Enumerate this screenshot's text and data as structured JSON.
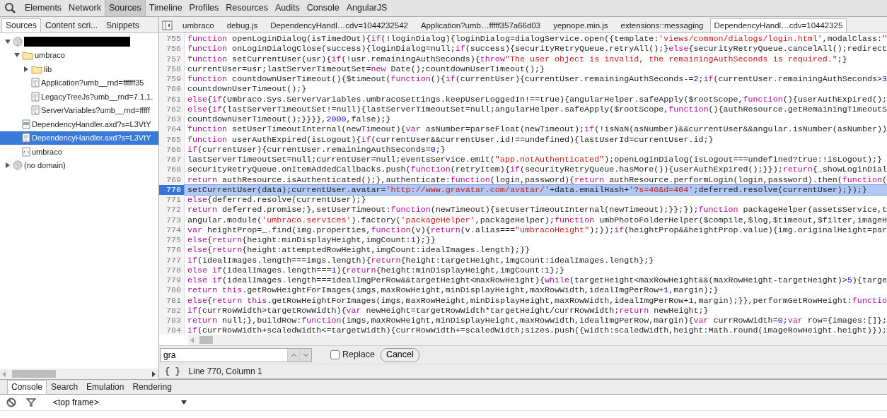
{
  "toolbar": {
    "tabs": [
      {
        "label": "Elements",
        "selected": false
      },
      {
        "label": "Network",
        "selected": false
      },
      {
        "label": "Sources",
        "selected": true
      },
      {
        "label": "Timeline",
        "selected": false
      },
      {
        "label": "Profiles",
        "selected": false
      },
      {
        "label": "Resources",
        "selected": false
      },
      {
        "label": "Audits",
        "selected": false
      },
      {
        "label": "Console",
        "selected": false
      },
      {
        "label": "AngularJS",
        "selected": false
      }
    ]
  },
  "navigator": {
    "tabs": [
      {
        "label": "Sources",
        "selected": true
      },
      {
        "label": "Content scri...",
        "selected": false
      },
      {
        "label": "Snippets",
        "selected": false
      }
    ],
    "tree": [
      {
        "kind": "domain",
        "redacted": true,
        "expanded": true,
        "selected": false,
        "children": [
          {
            "kind": "folder",
            "label": "umbraco",
            "expanded": true,
            "selected": false,
            "children": [
              {
                "kind": "folder",
                "label": "lib",
                "expanded": false,
                "selected": false
              },
              {
                "kind": "script",
                "label": "Application?umb__rnd=ffffff35",
                "selected": false
              },
              {
                "kind": "script",
                "label": "LegacyTreeJs?umb__rnd=7.1.1.",
                "selected": false
              },
              {
                "kind": "script",
                "label": "ServerVariables?umb__rnd=fffff",
                "selected": false
              }
            ]
          },
          {
            "kind": "stylesheet",
            "label": "DependencyHandler.axd?s=L3VtY",
            "selected": false
          },
          {
            "kind": "script",
            "label": "DependencyHandler.axd?s=L3VtY",
            "selected": true
          },
          {
            "kind": "document",
            "label": "umbraco",
            "selected": false
          }
        ]
      },
      {
        "kind": "domain",
        "label": "(no domain)",
        "expanded": false,
        "selected": false
      }
    ]
  },
  "editor": {
    "tabs": [
      {
        "label": "umbraco",
        "selected": false
      },
      {
        "label": "debug.js",
        "selected": false
      },
      {
        "label": "DependencyHandl…cdv=1044232542",
        "selected": false
      },
      {
        "label": "Application?umb…fffff357a66d03",
        "selected": false
      },
      {
        "label": "yepnope.min.js",
        "selected": false
      },
      {
        "label": "extensions::messaging",
        "selected": false
      },
      {
        "label": "DependencyHandl…cdv=10442325",
        "selected": true
      }
    ],
    "lines": [
      {
        "number": "755",
        "selected": false,
        "code": [
          {
            "text": "function",
            "kind": "keyword"
          },
          {
            "text": " openLoginDialog(isTimedOut){",
            "kind": "plain"
          },
          {
            "text": "if",
            "kind": "keyword"
          },
          {
            "text": "(!loginDialog){loginDialog=dialogService.open({template:",
            "kind": "plain"
          },
          {
            "text": "'views/common/dialogs/login.html'",
            "kind": "string"
          },
          {
            "text": ",modalClass:",
            "kind": "plain"
          },
          {
            "text": "\"",
            "kind": "string"
          }
        ]
      },
      {
        "number": "756",
        "selected": false,
        "code": [
          {
            "text": "function",
            "kind": "keyword"
          },
          {
            "text": " onLoginDialogClose(success){loginDialog=null;",
            "kind": "plain"
          },
          {
            "text": "if",
            "kind": "keyword"
          },
          {
            "text": "(success){securityRetryQueue.retryAll();}",
            "kind": "plain"
          },
          {
            "text": "else",
            "kind": "keyword"
          },
          {
            "text": "{securityRetryQueue.cancelAll();redirect",
            "kind": "plain"
          }
        ]
      },
      {
        "number": "757",
        "selected": false,
        "code": [
          {
            "text": "function",
            "kind": "keyword"
          },
          {
            "text": " setCurrentUser(usr){",
            "kind": "plain"
          },
          {
            "text": "if",
            "kind": "keyword"
          },
          {
            "text": "(!usr.remainingAuthSeconds){",
            "kind": "plain"
          },
          {
            "text": "throw",
            "kind": "keyword"
          },
          {
            "text": "\"The user object is invalid, the remainingAuthSeconds is required.\"",
            "kind": "string"
          },
          {
            "text": ";}",
            "kind": "plain"
          }
        ]
      },
      {
        "number": "758",
        "selected": false,
        "code": [
          {
            "text": "currentUser=usr;lastServerTimeoutSet=",
            "kind": "plain"
          },
          {
            "text": "new",
            "kind": "keyword"
          },
          {
            "text": " Date();countdownUserTimeout();}",
            "kind": "plain"
          }
        ]
      },
      {
        "number": "759",
        "selected": false,
        "code": [
          {
            "text": "function",
            "kind": "keyword"
          },
          {
            "text": " countdownUserTimeout(){$timeout(",
            "kind": "plain"
          },
          {
            "text": "function",
            "kind": "keyword"
          },
          {
            "text": "(){",
            "kind": "plain"
          },
          {
            "text": "if",
            "kind": "keyword"
          },
          {
            "text": "(currentUser){currentUser.remainingAuthSeconds-=",
            "kind": "plain"
          },
          {
            "text": "2",
            "kind": "number"
          },
          {
            "text": ";",
            "kind": "plain"
          },
          {
            "text": "if",
            "kind": "keyword"
          },
          {
            "text": "(currentUser.remainingAuthSeconds>",
            "kind": "plain"
          },
          {
            "text": "3",
            "kind": "number"
          }
        ]
      },
      {
        "number": "760",
        "selected": false,
        "code": [
          {
            "text": "countdownUserTimeout();}",
            "kind": "plain"
          }
        ]
      },
      {
        "number": "761",
        "selected": false,
        "code": [
          {
            "text": "else",
            "kind": "keyword"
          },
          {
            "text": "{",
            "kind": "plain"
          },
          {
            "text": "if",
            "kind": "keyword"
          },
          {
            "text": "(Umbraco.Sys.ServerVariables.umbracoSettings.keepUserLoggedIn!==true){angularHelper.safeApply($rootScope,",
            "kind": "plain"
          },
          {
            "text": "function",
            "kind": "keyword"
          },
          {
            "text": "(){userAuthExpired();",
            "kind": "plain"
          }
        ]
      },
      {
        "number": "762",
        "selected": false,
        "code": [
          {
            "text": "else",
            "kind": "keyword"
          },
          {
            "text": "{",
            "kind": "plain"
          },
          {
            "text": "if",
            "kind": "keyword"
          },
          {
            "text": "(lastServerTimeoutSet!=null){lastServerTimeoutSet=null;angularHelper.safeApply($rootScope,",
            "kind": "plain"
          },
          {
            "text": "function",
            "kind": "keyword"
          },
          {
            "text": "(){authResource.getRemainingTimeoutS",
            "kind": "plain"
          }
        ]
      },
      {
        "number": "763",
        "selected": false,
        "code": [
          {
            "text": "countdownUserTimeout();}}}},",
            "kind": "plain"
          },
          {
            "text": "2000",
            "kind": "number"
          },
          {
            "text": ",false);}",
            "kind": "plain"
          }
        ]
      },
      {
        "number": "764",
        "selected": false,
        "code": [
          {
            "text": "function",
            "kind": "keyword"
          },
          {
            "text": " setUserTimeoutInternal(newTimeout){",
            "kind": "plain"
          },
          {
            "text": "var",
            "kind": "keyword"
          },
          {
            "text": " asNumber=parseFloat(newTimeout);",
            "kind": "plain"
          },
          {
            "text": "if",
            "kind": "keyword"
          },
          {
            "text": "(!isNaN(asNumber)&&currentUser&&angular.isNumber(asNumber))",
            "kind": "plain"
          }
        ]
      },
      {
        "number": "765",
        "selected": false,
        "code": [
          {
            "text": "function",
            "kind": "keyword"
          },
          {
            "text": " userAuthExpired(isLogout){",
            "kind": "plain"
          },
          {
            "text": "if",
            "kind": "keyword"
          },
          {
            "text": "(currentUser&&currentUser.id!==undefined){lastUserId=currentUser.id;}",
            "kind": "plain"
          }
        ]
      },
      {
        "number": "766",
        "selected": false,
        "code": [
          {
            "text": "if",
            "kind": "keyword"
          },
          {
            "text": "(currentUser){currentUser.remainingAuthSeconds=",
            "kind": "plain"
          },
          {
            "text": "0",
            "kind": "number"
          },
          {
            "text": ";}",
            "kind": "plain"
          }
        ]
      },
      {
        "number": "767",
        "selected": false,
        "code": [
          {
            "text": "lastServerTimeoutSet=null;currentUser=null;eventsService.emit(",
            "kind": "plain"
          },
          {
            "text": "\"app.notAuthenticated\"",
            "kind": "string"
          },
          {
            "text": ");openLoginDialog(isLogout===undefined?true:!isLogout);}",
            "kind": "plain"
          }
        ]
      },
      {
        "number": "768",
        "selected": false,
        "code": [
          {
            "text": "securityRetryQueue.onItemAddedCallbacks.push(",
            "kind": "plain"
          },
          {
            "text": "function",
            "kind": "keyword"
          },
          {
            "text": "(retryItem){",
            "kind": "plain"
          },
          {
            "text": "if",
            "kind": "keyword"
          },
          {
            "text": "(securityRetryQueue.hasMore()){userAuthExpired();}});",
            "kind": "plain"
          },
          {
            "text": "return",
            "kind": "keyword"
          },
          {
            "text": "{_showLoginDial",
            "kind": "plain"
          }
        ]
      },
      {
        "number": "769",
        "selected": false,
        "code": [
          {
            "text": "return",
            "kind": "keyword"
          },
          {
            "text": " authResource.isAuthenticated();},authenticate:",
            "kind": "plain"
          },
          {
            "text": "function",
            "kind": "keyword"
          },
          {
            "text": "(login,password){",
            "kind": "plain"
          },
          {
            "text": "return",
            "kind": "keyword"
          },
          {
            "text": " authResource.performLogin(login,password).then(",
            "kind": "plain"
          },
          {
            "text": "function",
            "kind": "keyword"
          },
          {
            "text": "(",
            "kind": "plain"
          }
        ]
      },
      {
        "number": "770",
        "selected": true,
        "code": [
          {
            "text": "setCurrentUser(data);currentUser.avatar=",
            "kind": "plain"
          },
          {
            "text": "'http://www.gravatar.com/avatar/'",
            "kind": "string"
          },
          {
            "text": "+data.emailHash+",
            "kind": "plain"
          },
          {
            "text": "'?s=40&d=404'",
            "kind": "string"
          },
          {
            "text": ";deferred.resolve(currentUser);});}",
            "kind": "plain"
          }
        ]
      },
      {
        "number": "771",
        "selected": false,
        "code": [
          {
            "text": "else",
            "kind": "keyword"
          },
          {
            "text": "{deferred.resolve(currentUser);}",
            "kind": "plain"
          }
        ]
      },
      {
        "number": "772",
        "selected": false,
        "code": [
          {
            "text": "return",
            "kind": "keyword"
          },
          {
            "text": " deferred.promise;},setUserTimeout:",
            "kind": "plain"
          },
          {
            "text": "function",
            "kind": "keyword"
          },
          {
            "text": "(newTimeout){setUserTimeoutInternal(newTimeout);}};});",
            "kind": "plain"
          },
          {
            "text": "function",
            "kind": "keyword"
          },
          {
            "text": " packageHelper(assetsService,t",
            "kind": "plain"
          }
        ]
      },
      {
        "number": "773",
        "selected": false,
        "code": [
          {
            "text": "angular.module(",
            "kind": "plain"
          },
          {
            "text": "'umbraco.services'",
            "kind": "string"
          },
          {
            "text": ").factory(",
            "kind": "plain"
          },
          {
            "text": "'packageHelper'",
            "kind": "string"
          },
          {
            "text": ",packageHelper);",
            "kind": "plain"
          },
          {
            "text": "function",
            "kind": "keyword"
          },
          {
            "text": " umbPhotoFolderHelper($compile,$log,$timeout,$filter,imageH",
            "kind": "plain"
          }
        ]
      },
      {
        "number": "774",
        "selected": false,
        "code": [
          {
            "text": "var",
            "kind": "keyword"
          },
          {
            "text": " heightProp=_.find(img.properties,",
            "kind": "plain"
          },
          {
            "text": "function",
            "kind": "keyword"
          },
          {
            "text": "(v){",
            "kind": "plain"
          },
          {
            "text": "return",
            "kind": "keyword"
          },
          {
            "text": "(v.alias===",
            "kind": "plain"
          },
          {
            "text": "\"umbracoHeight\"",
            "kind": "string"
          },
          {
            "text": ");});",
            "kind": "plain"
          },
          {
            "text": "if",
            "kind": "keyword"
          },
          {
            "text": "(heightProp&&heightProp.value){img.originalHeight=par",
            "kind": "plain"
          }
        ]
      },
      {
        "number": "775",
        "selected": false,
        "code": [
          {
            "text": "else",
            "kind": "keyword"
          },
          {
            "text": "{",
            "kind": "plain"
          },
          {
            "text": "return",
            "kind": "keyword"
          },
          {
            "text": "{height:minDisplayHeight,imgCount:",
            "kind": "plain"
          },
          {
            "text": "1",
            "kind": "number"
          },
          {
            "text": "};}}",
            "kind": "plain"
          }
        ]
      },
      {
        "number": "776",
        "selected": false,
        "code": [
          {
            "text": "else",
            "kind": "keyword"
          },
          {
            "text": "{",
            "kind": "plain"
          },
          {
            "text": "return",
            "kind": "keyword"
          },
          {
            "text": "{height:attemptedRowHeight,imgCount:idealImages.length};}}",
            "kind": "plain"
          }
        ]
      },
      {
        "number": "777",
        "selected": false,
        "code": [
          {
            "text": "if",
            "kind": "keyword"
          },
          {
            "text": "(idealImages.length===imgs.length){",
            "kind": "plain"
          },
          {
            "text": "return",
            "kind": "keyword"
          },
          {
            "text": "{height:targetHeight,imgCount:idealImages.length};}",
            "kind": "plain"
          }
        ]
      },
      {
        "number": "778",
        "selected": false,
        "code": [
          {
            "text": "else if",
            "kind": "keyword"
          },
          {
            "text": "(idealImages.length===",
            "kind": "plain"
          },
          {
            "text": "1",
            "kind": "number"
          },
          {
            "text": "){",
            "kind": "plain"
          },
          {
            "text": "return",
            "kind": "keyword"
          },
          {
            "text": "{height:minDisplayHeight,imgCount:",
            "kind": "plain"
          },
          {
            "text": "1",
            "kind": "number"
          },
          {
            "text": "};}",
            "kind": "plain"
          }
        ]
      },
      {
        "number": "779",
        "selected": false,
        "code": [
          {
            "text": "else if",
            "kind": "keyword"
          },
          {
            "text": "(idealImages.length===idealImgPerRow&&targetHeight<maxRowHeight){",
            "kind": "plain"
          },
          {
            "text": "while",
            "kind": "keyword"
          },
          {
            "text": "(targetHeight<maxRowHeight&&(maxRowHeight-targetHeight)>",
            "kind": "plain"
          },
          {
            "text": "5",
            "kind": "number"
          },
          {
            "text": "){targe",
            "kind": "plain"
          }
        ]
      },
      {
        "number": "780",
        "selected": false,
        "code": [
          {
            "text": "return this",
            "kind": "keyword"
          },
          {
            "text": ".getRowHeightForImages(imgs,maxRowHeight,minDisplayHeight,maxRowWidth,idealImgPerRow+",
            "kind": "plain"
          },
          {
            "text": "1",
            "kind": "number"
          },
          {
            "text": ",margin);}",
            "kind": "plain"
          }
        ]
      },
      {
        "number": "781",
        "selected": false,
        "code": [
          {
            "text": "else",
            "kind": "keyword"
          },
          {
            "text": "{",
            "kind": "plain"
          },
          {
            "text": "return this",
            "kind": "keyword"
          },
          {
            "text": ".getRowHeightForImages(imgs,maxRowHeight,minDisplayHeight,maxRowWidth,idealImgPerRow+",
            "kind": "plain"
          },
          {
            "text": "1",
            "kind": "number"
          },
          {
            "text": ",margin);}},performGetRowHeight:",
            "kind": "plain"
          },
          {
            "text": "functio",
            "kind": "keyword"
          }
        ]
      },
      {
        "number": "782",
        "selected": false,
        "code": [
          {
            "text": "if",
            "kind": "keyword"
          },
          {
            "text": "(currRowWidth>targetRowWidth){",
            "kind": "plain"
          },
          {
            "text": "var",
            "kind": "keyword"
          },
          {
            "text": " newHeight=targetRowWidth*targetHeight/currRowWidth;",
            "kind": "plain"
          },
          {
            "text": "return",
            "kind": "keyword"
          },
          {
            "text": " newHeight;}",
            "kind": "plain"
          }
        ]
      },
      {
        "number": "783",
        "selected": false,
        "code": [
          {
            "text": "return",
            "kind": "keyword"
          },
          {
            "text": " null;},buildRow:",
            "kind": "plain"
          },
          {
            "text": "function",
            "kind": "keyword"
          },
          {
            "text": "(imgs,maxRowHeight,minDisplayHeight,maxRowWidth,idealImgPerRow,margin){",
            "kind": "plain"
          },
          {
            "text": "var",
            "kind": "keyword"
          },
          {
            "text": " currRowWidth=",
            "kind": "plain"
          },
          {
            "text": "0",
            "kind": "number"
          },
          {
            "text": ";",
            "kind": "plain"
          },
          {
            "text": "var",
            "kind": "keyword"
          },
          {
            "text": " row={images:[]};",
            "kind": "plain"
          }
        ]
      },
      {
        "number": "784",
        "selected": false,
        "code": [
          {
            "text": "if",
            "kind": "keyword"
          },
          {
            "text": "(currRowWidth+scaledWidth<=targetWidth){currRowWidth+=scaledWidth;sizes.push({width:scaledWidth,height:Math.round(imageRowHeight.height)});",
            "kind": "plain"
          }
        ]
      }
    ]
  },
  "search_bar": {
    "value": "gra",
    "replace_checked": false,
    "replace_label": "Replace",
    "cancel": "Cancel"
  },
  "status_bar": {
    "pretty_print": "{ }",
    "position": "Line 770, Column 1"
  },
  "drawer": {
    "tabs": [
      {
        "label": "Console",
        "selected": true
      },
      {
        "label": "Search",
        "selected": false
      },
      {
        "label": "Emulation",
        "selected": false
      },
      {
        "label": "Rendering",
        "selected": false
      }
    ],
    "frame": "<top frame>"
  }
}
